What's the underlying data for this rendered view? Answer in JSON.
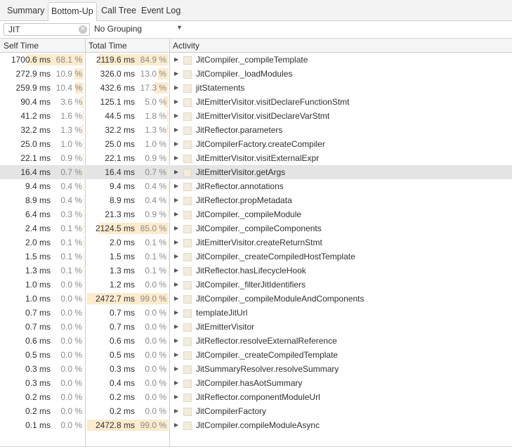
{
  "tabs": [
    {
      "label": "Summary",
      "active": false
    },
    {
      "label": "Bottom-Up",
      "active": true
    },
    {
      "label": "Call Tree",
      "active": false
    },
    {
      "label": "Event Log",
      "active": false
    }
  ],
  "filter": {
    "value": "JIT",
    "grouping": "No Grouping"
  },
  "columns": {
    "self_time": "Self Time",
    "total_time": "Total Time",
    "activity": "Activity"
  },
  "colors": {
    "bar": "#fcebcd",
    "selected_row": "#e4e4e4"
  },
  "rows": [
    {
      "self_ms": "1700.6 ms",
      "self_pct": "68.1 %",
      "self_frac": 0.681,
      "total_ms": "2119.6 ms",
      "total_pct": "84.9 %",
      "total_frac": 0.849,
      "activity": "JitCompiler._compileTemplate",
      "selected": false
    },
    {
      "self_ms": "272.9 ms",
      "self_pct": "10.9 %",
      "self_frac": 0.109,
      "total_ms": "326.0 ms",
      "total_pct": "13.0 %",
      "total_frac": 0.13,
      "activity": "JitCompiler._loadModules",
      "selected": false
    },
    {
      "self_ms": "259.9 ms",
      "self_pct": "10.4 %",
      "self_frac": 0.104,
      "total_ms": "432.6 ms",
      "total_pct": "17.3 %",
      "total_frac": 0.173,
      "activity": "jitStatements",
      "selected": false
    },
    {
      "self_ms": "90.4 ms",
      "self_pct": "3.6 %",
      "self_frac": 0.036,
      "total_ms": "125.1 ms",
      "total_pct": "5.0 %",
      "total_frac": 0.05,
      "activity": "JitEmitterVisitor.visitDeclareFunctionStmt",
      "selected": false
    },
    {
      "self_ms": "41.2 ms",
      "self_pct": "1.6 %",
      "self_frac": 0.016,
      "total_ms": "44.5 ms",
      "total_pct": "1.8 %",
      "total_frac": 0.018,
      "activity": "JitEmitterVisitor.visitDeclareVarStmt",
      "selected": false
    },
    {
      "self_ms": "32.2 ms",
      "self_pct": "1.3 %",
      "self_frac": 0.013,
      "total_ms": "32.2 ms",
      "total_pct": "1.3 %",
      "total_frac": 0.013,
      "activity": "JitReflector.parameters",
      "selected": false
    },
    {
      "self_ms": "25.0 ms",
      "self_pct": "1.0 %",
      "self_frac": 0.01,
      "total_ms": "25.0 ms",
      "total_pct": "1.0 %",
      "total_frac": 0.01,
      "activity": "JitCompilerFactory.createCompiler",
      "selected": false
    },
    {
      "self_ms": "22.1 ms",
      "self_pct": "0.9 %",
      "self_frac": 0.009,
      "total_ms": "22.1 ms",
      "total_pct": "0.9 %",
      "total_frac": 0.009,
      "activity": "JitEmitterVisitor.visitExternalExpr",
      "selected": false
    },
    {
      "self_ms": "16.4 ms",
      "self_pct": "0.7 %",
      "self_frac": 0.007,
      "total_ms": "16.4 ms",
      "total_pct": "0.7 %",
      "total_frac": 0.007,
      "activity": "JitEmitterVisitor.getArgs",
      "selected": true
    },
    {
      "self_ms": "9.4 ms",
      "self_pct": "0.4 %",
      "self_frac": 0.004,
      "total_ms": "9.4 ms",
      "total_pct": "0.4 %",
      "total_frac": 0.004,
      "activity": "JitReflector.annotations",
      "selected": false
    },
    {
      "self_ms": "8.9 ms",
      "self_pct": "0.4 %",
      "self_frac": 0.004,
      "total_ms": "8.9 ms",
      "total_pct": "0.4 %",
      "total_frac": 0.004,
      "activity": "JitReflector.propMetadata",
      "selected": false
    },
    {
      "self_ms": "6.4 ms",
      "self_pct": "0.3 %",
      "self_frac": 0.003,
      "total_ms": "21.3 ms",
      "total_pct": "0.9 %",
      "total_frac": 0.009,
      "activity": "JitCompiler._compileModule",
      "selected": false
    },
    {
      "self_ms": "2.4 ms",
      "self_pct": "0.1 %",
      "self_frac": 0.001,
      "total_ms": "2124.5 ms",
      "total_pct": "85.0 %",
      "total_frac": 0.85,
      "activity": "JitCompiler._compileComponents",
      "selected": false
    },
    {
      "self_ms": "2.0 ms",
      "self_pct": "0.1 %",
      "self_frac": 0.001,
      "total_ms": "2.0 ms",
      "total_pct": "0.1 %",
      "total_frac": 0.001,
      "activity": "JitEmitterVisitor.createReturnStmt",
      "selected": false
    },
    {
      "self_ms": "1.5 ms",
      "self_pct": "0.1 %",
      "self_frac": 0.001,
      "total_ms": "1.5 ms",
      "total_pct": "0.1 %",
      "total_frac": 0.001,
      "activity": "JitCompiler._createCompiledHostTemplate",
      "selected": false
    },
    {
      "self_ms": "1.3 ms",
      "self_pct": "0.1 %",
      "self_frac": 0.001,
      "total_ms": "1.3 ms",
      "total_pct": "0.1 %",
      "total_frac": 0.001,
      "activity": "JitReflector.hasLifecycleHook",
      "selected": false
    },
    {
      "self_ms": "1.0 ms",
      "self_pct": "0.0 %",
      "self_frac": 0.0,
      "total_ms": "1.2 ms",
      "total_pct": "0.0 %",
      "total_frac": 0.0,
      "activity": "JitCompiler._filterJitIdentifiers",
      "selected": false
    },
    {
      "self_ms": "1.0 ms",
      "self_pct": "0.0 %",
      "self_frac": 0.0,
      "total_ms": "2472.7 ms",
      "total_pct": "99.0 %",
      "total_frac": 0.99,
      "activity": "JitCompiler._compileModuleAndComponents",
      "selected": false
    },
    {
      "self_ms": "0.7 ms",
      "self_pct": "0.0 %",
      "self_frac": 0.0,
      "total_ms": "0.7 ms",
      "total_pct": "0.0 %",
      "total_frac": 0.0,
      "activity": "templateJitUrl",
      "selected": false
    },
    {
      "self_ms": "0.7 ms",
      "self_pct": "0.0 %",
      "self_frac": 0.0,
      "total_ms": "0.7 ms",
      "total_pct": "0.0 %",
      "total_frac": 0.0,
      "activity": "JitEmitterVisitor",
      "selected": false
    },
    {
      "self_ms": "0.6 ms",
      "self_pct": "0.0 %",
      "self_frac": 0.0,
      "total_ms": "0.6 ms",
      "total_pct": "0.0 %",
      "total_frac": 0.0,
      "activity": "JitReflector.resolveExternalReference",
      "selected": false
    },
    {
      "self_ms": "0.5 ms",
      "self_pct": "0.0 %",
      "self_frac": 0.0,
      "total_ms": "0.5 ms",
      "total_pct": "0.0 %",
      "total_frac": 0.0,
      "activity": "JitCompiler._createCompiledTemplate",
      "selected": false
    },
    {
      "self_ms": "0.3 ms",
      "self_pct": "0.0 %",
      "self_frac": 0.0,
      "total_ms": "0.3 ms",
      "total_pct": "0.0 %",
      "total_frac": 0.0,
      "activity": "JitSummaryResolver.resolveSummary",
      "selected": false
    },
    {
      "self_ms": "0.3 ms",
      "self_pct": "0.0 %",
      "self_frac": 0.0,
      "total_ms": "0.4 ms",
      "total_pct": "0.0 %",
      "total_frac": 0.0,
      "activity": "JitCompiler.hasAotSummary",
      "selected": false
    },
    {
      "self_ms": "0.2 ms",
      "self_pct": "0.0 %",
      "self_frac": 0.0,
      "total_ms": "0.2 ms",
      "total_pct": "0.0 %",
      "total_frac": 0.0,
      "activity": "JitReflector.componentModuleUrl",
      "selected": false
    },
    {
      "self_ms": "0.2 ms",
      "self_pct": "0.0 %",
      "self_frac": 0.0,
      "total_ms": "0.2 ms",
      "total_pct": "0.0 %",
      "total_frac": 0.0,
      "activity": "JitCompilerFactory",
      "selected": false
    },
    {
      "self_ms": "0.1 ms",
      "self_pct": "0.0 %",
      "self_frac": 0.0,
      "total_ms": "2472.8 ms",
      "total_pct": "99.0 %",
      "total_frac": 0.99,
      "activity": "JitCompiler.compileModuleAsync",
      "selected": false
    }
  ]
}
